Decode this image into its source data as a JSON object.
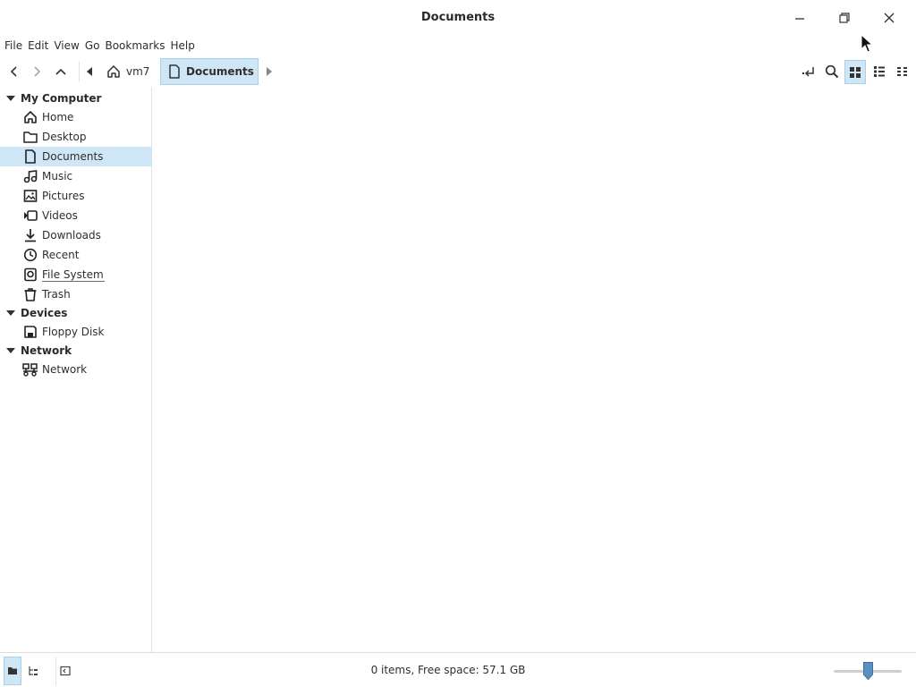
{
  "window": {
    "title": "Documents",
    "controls": [
      "minimize",
      "maximize",
      "close"
    ]
  },
  "menubar": {
    "items": [
      "File",
      "Edit",
      "View",
      "Go",
      "Bookmarks",
      "Help"
    ]
  },
  "toolbar": {
    "nav": [
      "back-icon",
      "forward-icon",
      "up-icon"
    ],
    "breadcrumb": [
      {
        "label": "vm7",
        "icon": "home-icon"
      },
      {
        "label": "Documents",
        "icon": "document-icon",
        "active": true
      }
    ],
    "right_tools": [
      "toggle-location-icon",
      "search-icon",
      "icon-view-icon",
      "list-view-icon",
      "compact-view-icon"
    ],
    "active_view": "icon-view"
  },
  "sidebar": {
    "sections": [
      {
        "title": "My Computer",
        "items": [
          {
            "label": "Home",
            "icon": "home-icon"
          },
          {
            "label": "Desktop",
            "icon": "folder-icon"
          },
          {
            "label": "Documents",
            "icon": "document-icon",
            "selected": true
          },
          {
            "label": "Music",
            "icon": "music-icon"
          },
          {
            "label": "Pictures",
            "icon": "picture-icon"
          },
          {
            "label": "Videos",
            "icon": "video-icon"
          },
          {
            "label": "Downloads",
            "icon": "download-icon"
          },
          {
            "label": "Recent",
            "icon": "clock-icon"
          },
          {
            "label": "File System",
            "icon": "drive-icon"
          },
          {
            "label": "Trash",
            "icon": "trash-icon"
          }
        ]
      },
      {
        "title": "Devices",
        "items": [
          {
            "label": "Floppy Disk",
            "icon": "floppy-icon"
          }
        ]
      },
      {
        "title": "Network",
        "items": [
          {
            "label": "Network",
            "icon": "network-icon"
          }
        ]
      }
    ]
  },
  "statusbar": {
    "text": "0 items, Free space: 57.1 GB",
    "zoom_fraction": 0.5
  },
  "colors": {
    "selection": "#cfe6f6",
    "selection_border": "#a9cfe9",
    "text": "#2e2e2e"
  }
}
